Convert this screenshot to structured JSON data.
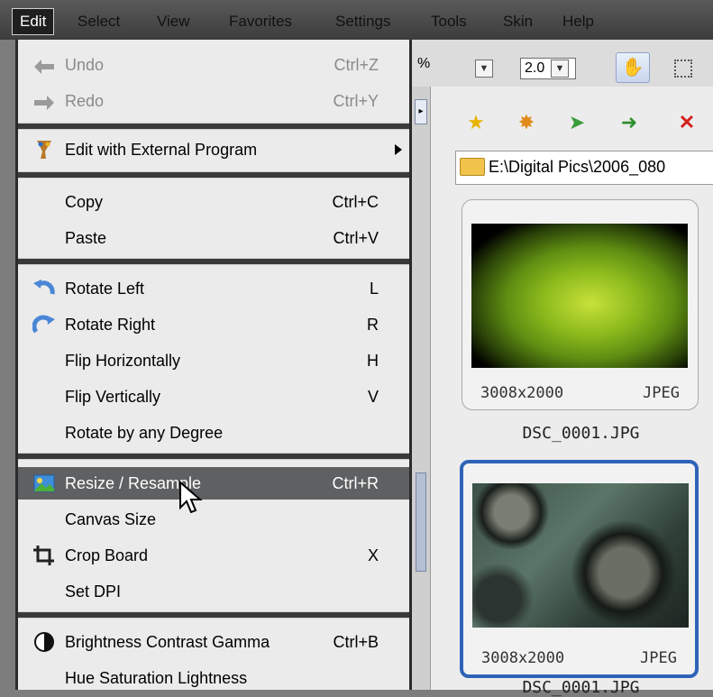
{
  "menubar": {
    "items": [
      "Edit",
      "Select",
      "View",
      "Favorites",
      "Settings",
      "Tools",
      "Skin",
      "Help"
    ]
  },
  "toolbar": {
    "zoom_partial": "%",
    "ratio_value": "2.0"
  },
  "browser": {
    "path": "E:\\Digital Pics\\2006_080",
    "thumbs": [
      {
        "dimensions": "3008x2000",
        "format": "JPEG",
        "filename": "DSC_0001.JPG",
        "selected": false
      },
      {
        "dimensions": "3008x2000",
        "format": "JPEG",
        "filename": "DSC_0001.JPG",
        "selected": true
      }
    ]
  },
  "edit_menu": {
    "undo": {
      "label": "Undo",
      "shortcut": "Ctrl+Z"
    },
    "redo": {
      "label": "Redo",
      "shortcut": "Ctrl+Y"
    },
    "external": {
      "label": "Edit with External Program"
    },
    "copy": {
      "label": "Copy",
      "shortcut": "Ctrl+C"
    },
    "paste": {
      "label": "Paste",
      "shortcut": "Ctrl+V"
    },
    "rotate_left": {
      "label": "Rotate Left",
      "shortcut": "L"
    },
    "rotate_right": {
      "label": "Rotate Right",
      "shortcut": "R"
    },
    "flip_h": {
      "label": "Flip Horizontally",
      "shortcut": "H"
    },
    "flip_v": {
      "label": "Flip Vertically",
      "shortcut": "V"
    },
    "rotate_any": {
      "label": "Rotate by any Degree"
    },
    "resize": {
      "label": "Resize / Resample",
      "shortcut": "Ctrl+R"
    },
    "canvas": {
      "label": "Canvas Size"
    },
    "crop": {
      "label": "Crop Board",
      "shortcut": "X"
    },
    "dpi": {
      "label": "Set DPI"
    },
    "bcg": {
      "label": "Brightness Contrast Gamma",
      "shortcut": "Ctrl+B"
    },
    "hsl": {
      "label": "Hue Saturation Lightness"
    }
  },
  "colors": {
    "menu_highlight": "#5f6062",
    "selected_border": "#2e63b8"
  }
}
